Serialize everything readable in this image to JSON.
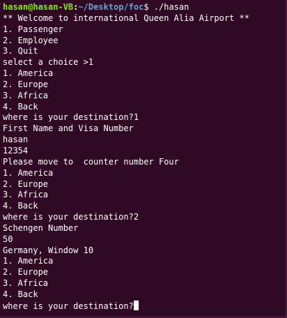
{
  "prompt": {
    "user_host": "hasan@hasan-VB",
    "separator": ":",
    "path": "~/Desktop/foc",
    "dollar": "$",
    "command": " ./hasan"
  },
  "output_lines": [
    "** Welcome to international Queen Alia Airport **",
    "1. Passenger",
    "2. Employee",
    "3. Quit",
    "select a choice >1",
    "1. America",
    "2. Europe",
    "3. Africa",
    "4. Back",
    "where is your destination?1",
    "First Name and Visa Number",
    "hasan",
    "12354",
    "Please move to  counter number Four",
    "1. America",
    "2. Europe",
    "3. Africa",
    "4. Back",
    "where is your destination?2",
    "Schengen Number",
    "50",
    "Germany, Window 10",
    "1. America",
    "2. Europe",
    "3. Africa",
    "4. Back",
    "where is your destination?"
  ],
  "colors": {
    "background": "#300a24",
    "prompt_user": "#8ae234",
    "prompt_path": "#729fcf",
    "text": "#ffffff"
  }
}
